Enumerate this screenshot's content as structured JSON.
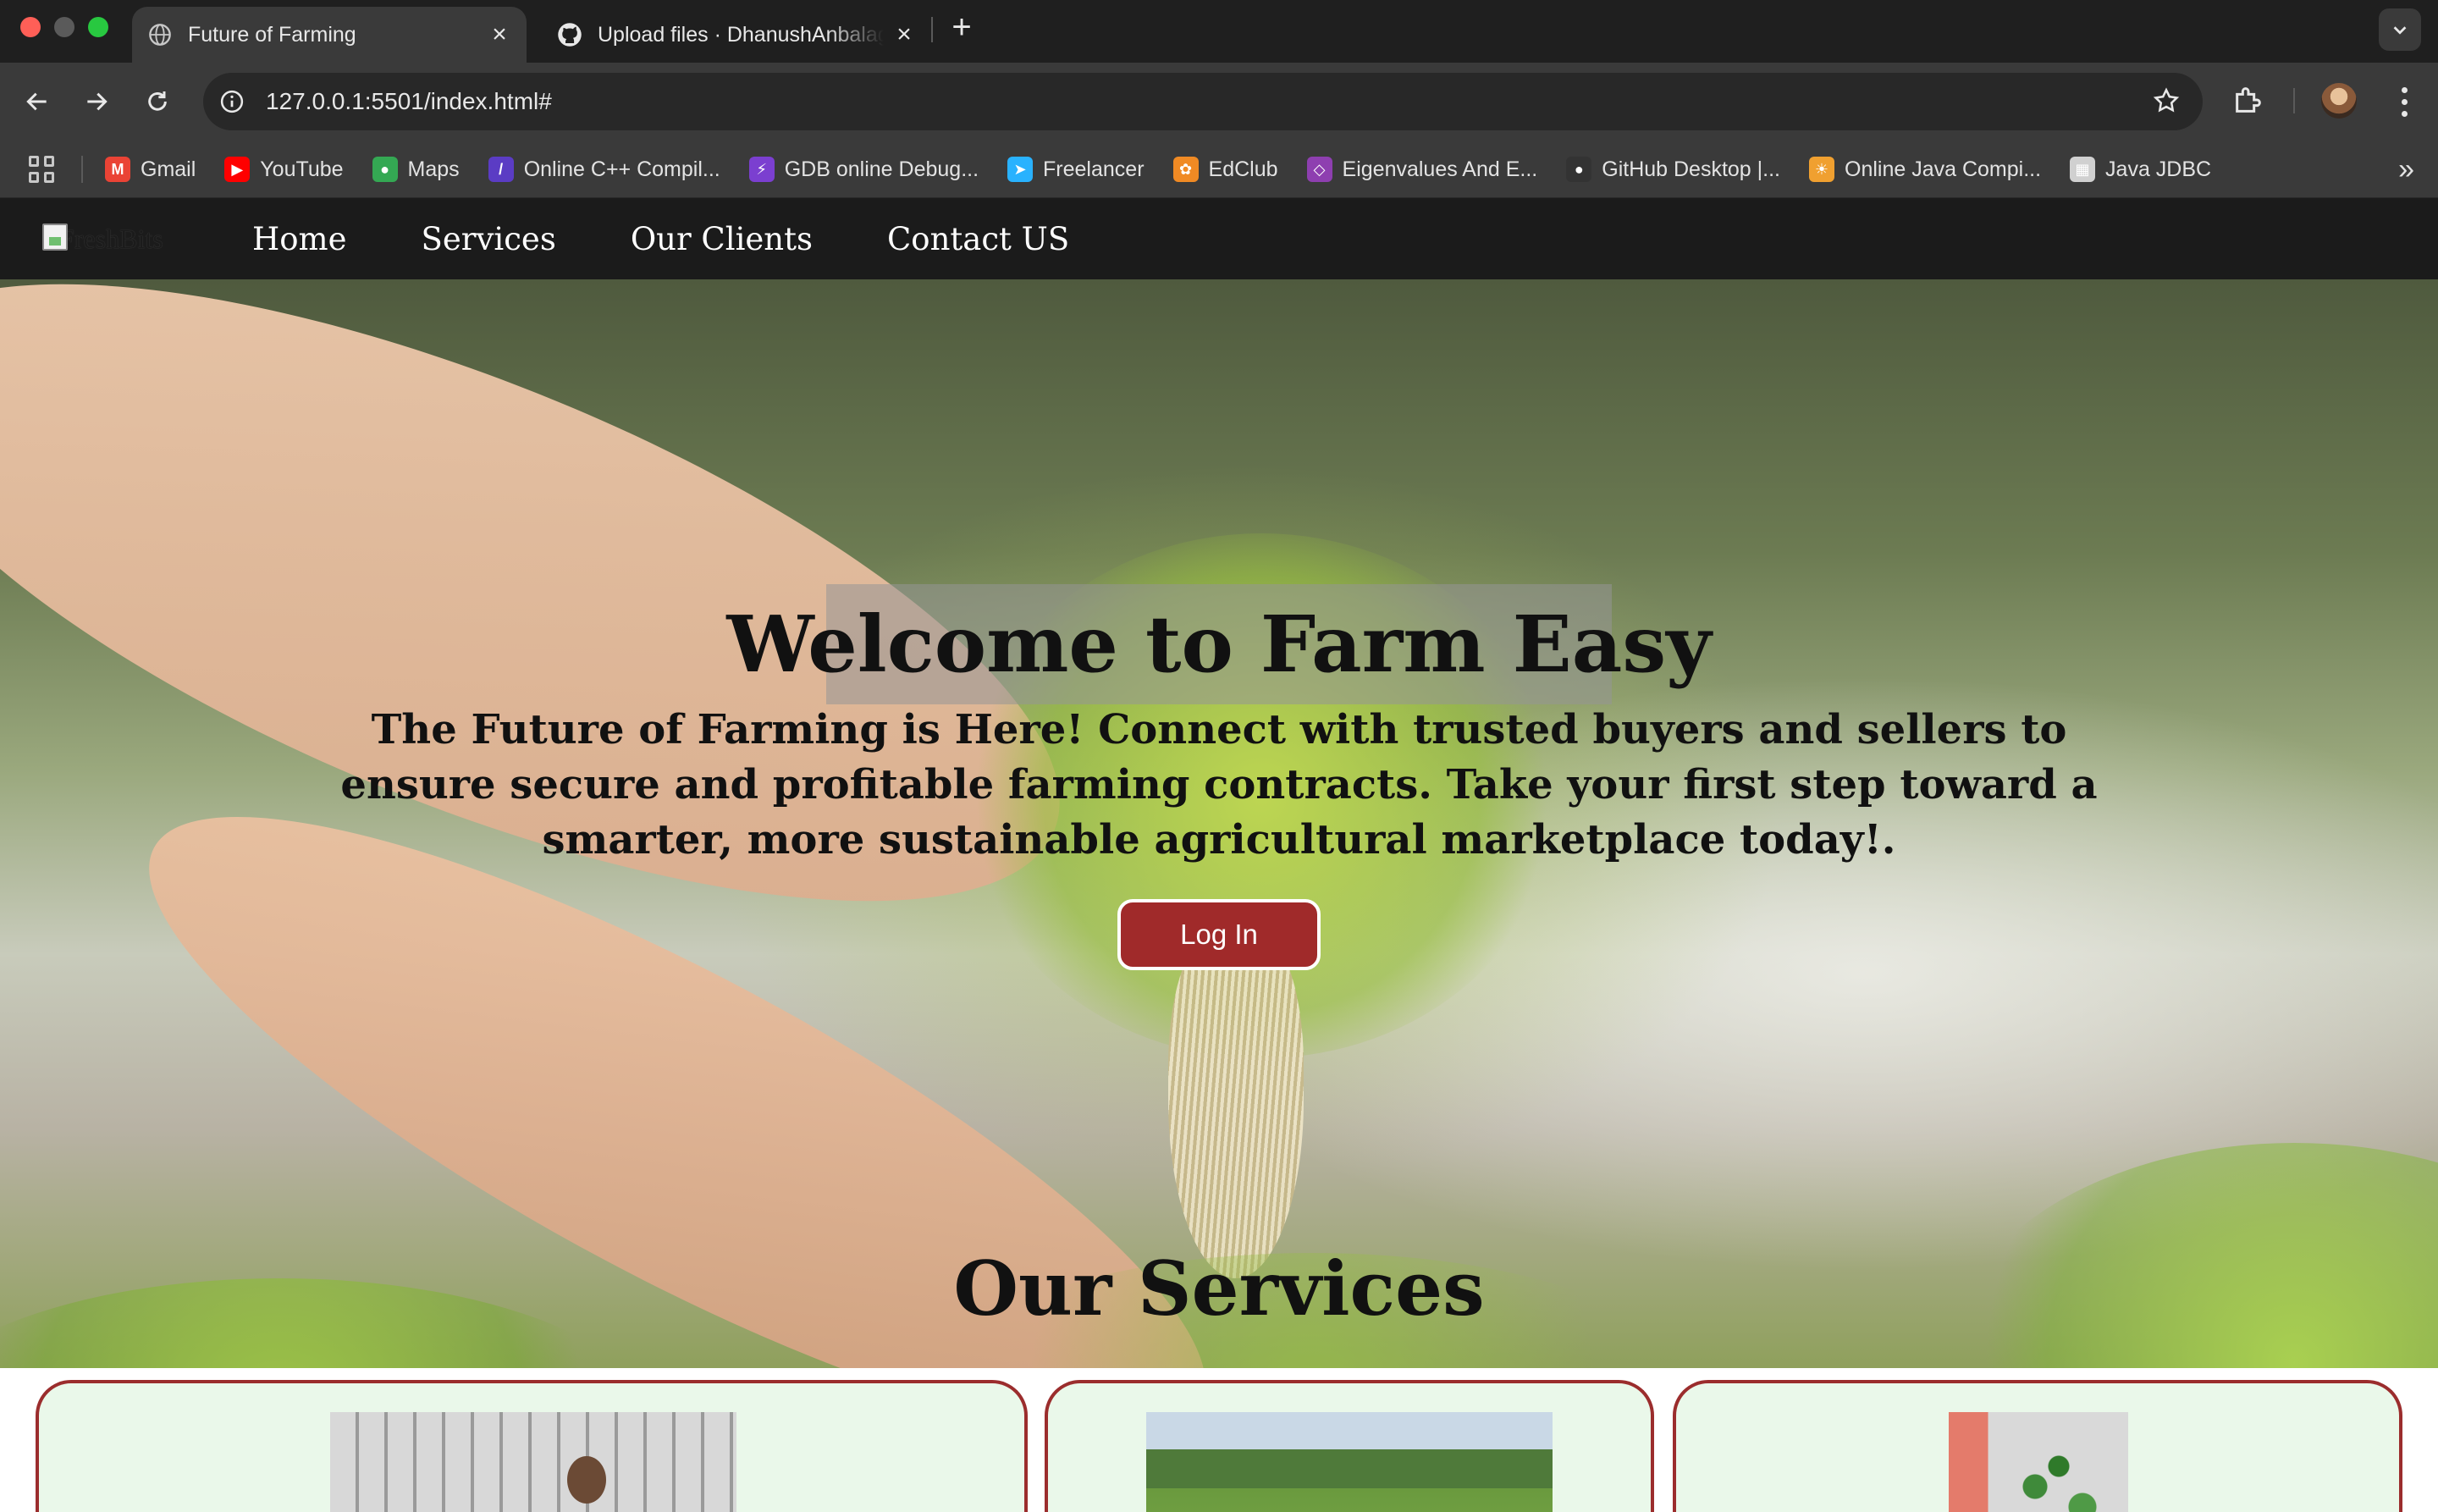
{
  "browser": {
    "tabs": [
      {
        "title": "Future of Farming",
        "active": true,
        "icon": "globe-icon"
      },
      {
        "title": "Upload files · DhanushAnbalagan",
        "active": false,
        "icon": "github-icon"
      }
    ],
    "url": "127.0.0.1:5501/index.html#",
    "bookmarks": [
      {
        "label": "Gmail",
        "icon": "gmail-icon",
        "color": "#ea4335"
      },
      {
        "label": "YouTube",
        "icon": "youtube-icon",
        "color": "#ff0000"
      },
      {
        "label": "Maps",
        "icon": "maps-icon",
        "color": "#34a853"
      },
      {
        "label": "Online C++ Compil...",
        "icon": "cpp-compiler-icon",
        "color": "#5b3cc4"
      },
      {
        "label": "GDB online Debug...",
        "icon": "gdb-icon",
        "color": "#7b3fd0"
      },
      {
        "label": "Freelancer",
        "icon": "freelancer-icon",
        "color": "#29b2fe"
      },
      {
        "label": "EdClub",
        "icon": "edclub-icon",
        "color": "#f08a24"
      },
      {
        "label": "Eigenvalues And E...",
        "icon": "eigen-icon",
        "color": "#8e3fb0"
      },
      {
        "label": "GitHub Desktop |...",
        "icon": "github-icon",
        "color": "#333333"
      },
      {
        "label": "Online Java Compi...",
        "icon": "java-compiler-icon",
        "color": "#f0a030"
      },
      {
        "label": "Java JDBC",
        "icon": "jdbc-icon",
        "color": "#d0d0d0"
      }
    ]
  },
  "site": {
    "logo_alt": "FreshBits",
    "nav": [
      "Home",
      "Services",
      "Our Clients",
      "Contact US"
    ],
    "hero": {
      "title": "Welcome to Farm Easy",
      "subtitle": "The Future of Farming is Here! Connect with trusted buyers and sellers to ensure secure and profitable farming contracts. Take your first step toward a smarter, more sustainable agricultural marketplace today!.",
      "login_label": "Log In"
    },
    "services_title": "Our Services"
  },
  "colors": {
    "accent": "#a02a2a",
    "card_bg": "#eaf8ea",
    "nav_bg": "#1b1b1b"
  }
}
